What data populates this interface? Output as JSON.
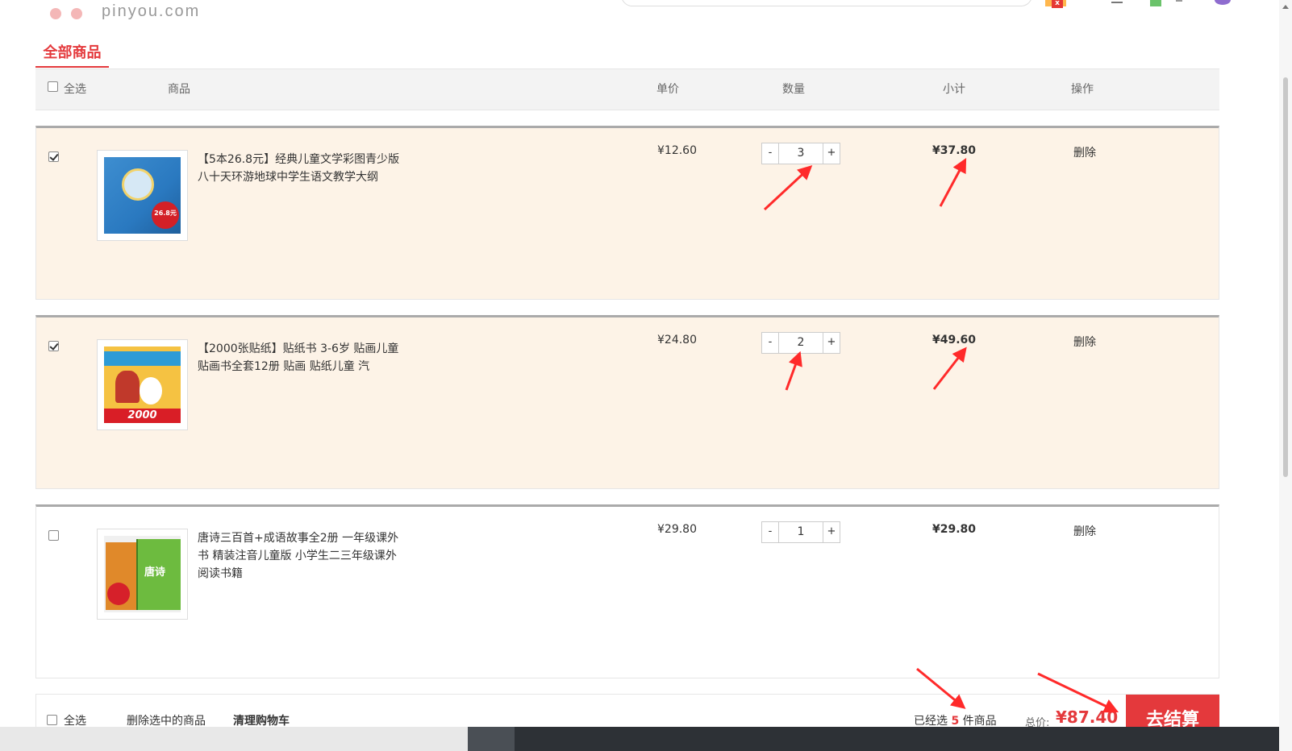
{
  "site": {
    "logo_text": "pinyou.com"
  },
  "tab": {
    "title": "全部商品"
  },
  "table_header": {
    "select_all": "全选",
    "product": "商品",
    "unit_price": "单价",
    "quantity": "数量",
    "subtotal": "小计",
    "action": "操作"
  },
  "items": [
    {
      "checked": true,
      "title": "【5本26.8元】经典儿童文学彩图青少版八十天环游地球中学生语文教学大纲",
      "price": "¥12.60",
      "minus": "-",
      "quantity": "3",
      "plus": "+",
      "subtotal": "¥37.80",
      "delete": "删除"
    },
    {
      "checked": true,
      "title": "【2000张贴纸】贴纸书 3-6岁 贴画儿童 贴画书全套12册 贴画 贴纸儿童 汽",
      "price": "¥24.80",
      "minus": "-",
      "quantity": "2",
      "plus": "+",
      "subtotal": "¥49.60",
      "delete": "删除"
    },
    {
      "checked": false,
      "title": "唐诗三百首+成语故事全2册 一年级课外书 精装注音儿童版 小学生二三年级课外阅读书籍",
      "price": "¥29.80",
      "minus": "-",
      "quantity": "1",
      "plus": "+",
      "subtotal": "¥29.80",
      "delete": "删除"
    }
  ],
  "book_covers": {
    "b1_badge": "26.8元",
    "b2_number": "2000",
    "b3_title": "唐诗"
  },
  "footer": {
    "select_all": "全选",
    "delete_selected": "删除选中的商品",
    "clear_cart": "清理购物车",
    "selected_prefix": "已经选",
    "selected_count": "5",
    "selected_suffix": "件商品",
    "total_label": "总价:",
    "total_value": "¥87.40",
    "checkout": "去结算"
  },
  "colors": {
    "accent": "#e4393c",
    "row_selected_bg": "#fdf3e7",
    "annotation_arrow": "#ff2a2a"
  }
}
